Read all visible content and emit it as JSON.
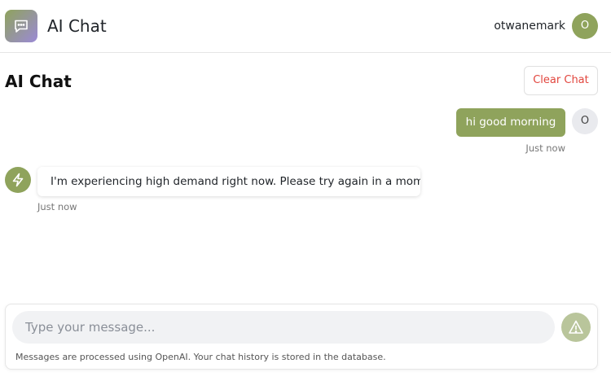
{
  "header": {
    "app_title": "AI Chat",
    "username": "otwanemark",
    "user_initial": "O"
  },
  "page": {
    "title": "AI Chat",
    "clear_label": "Clear Chat"
  },
  "messages": [
    {
      "role": "user",
      "text": "hi good morning",
      "time": "Just now",
      "avatar_initial": "O"
    },
    {
      "role": "assistant",
      "text": "I'm experiencing high demand right now. Please try again in a moment.",
      "time": "Just now",
      "avatar_icon": "bolt-icon"
    }
  ],
  "composer": {
    "placeholder": "Type your message...",
    "send_icon": "send-icon",
    "disclaimer": "Messages are processed using OpenAI. Your chat history is stored in the database."
  },
  "colors": {
    "accent": "#8fa35c",
    "send_disabled": "#b9c59b",
    "danger": "#e2463e",
    "logo_gradient_end": "#9b8ad6"
  }
}
